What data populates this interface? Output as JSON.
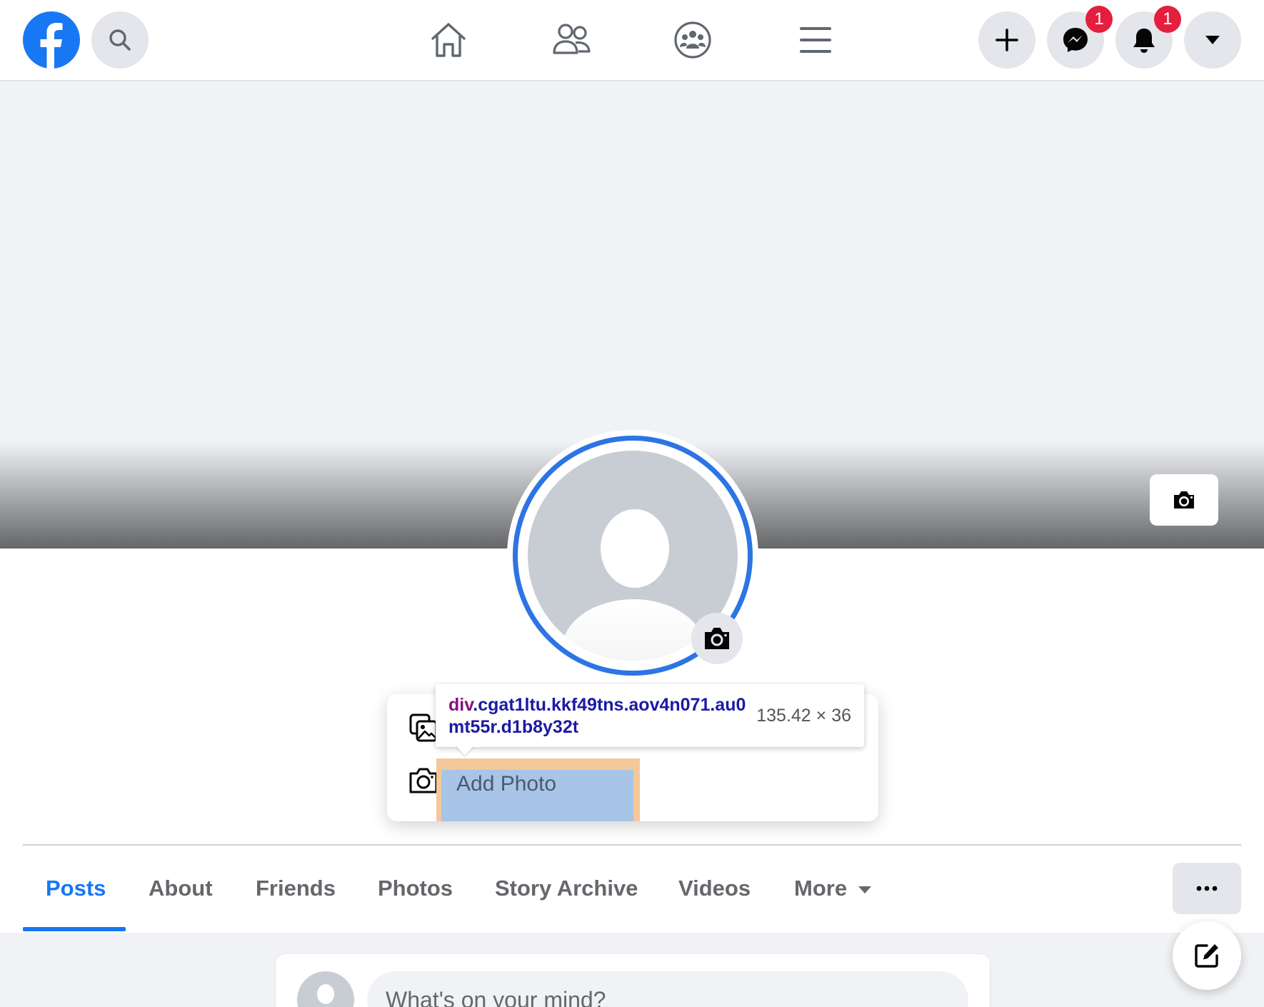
{
  "topbar": {
    "logo": "facebook-logo",
    "search_icon": "search-icon",
    "nav": [
      {
        "name": "home",
        "icon": "home-icon"
      },
      {
        "name": "friends",
        "icon": "friends-icon"
      },
      {
        "name": "groups",
        "icon": "groups-icon"
      },
      {
        "name": "menu",
        "icon": "hamburger-icon"
      }
    ],
    "actions": {
      "create_icon": "plus-icon",
      "messenger_badge": "1",
      "notifications_badge": "1",
      "account_icon": "caret-down-icon"
    }
  },
  "profile_menu": {
    "items": [
      {
        "label": "",
        "icon": "photos-icon"
      },
      {
        "label": "Add Photo",
        "icon": "camera-icon"
      }
    ]
  },
  "inspector": {
    "tag": "div",
    "selector": ".cgat1ltu.kkf49tns.aov4n071.au0mt55r.d1b8y32t",
    "size": "135.42 × 36"
  },
  "tabs": [
    "Posts",
    "About",
    "Friends",
    "Photos",
    "Story Archive",
    "Videos",
    "More"
  ],
  "active_tab": "Posts",
  "composer": {
    "placeholder": "What's on your mind?"
  },
  "colors": {
    "brand": "#1877f2",
    "badge": "#e41e3f",
    "profile_ring": "#2d74e4",
    "highlight_content": "#a8c4e6",
    "highlight_padding": "#f4c89a"
  }
}
